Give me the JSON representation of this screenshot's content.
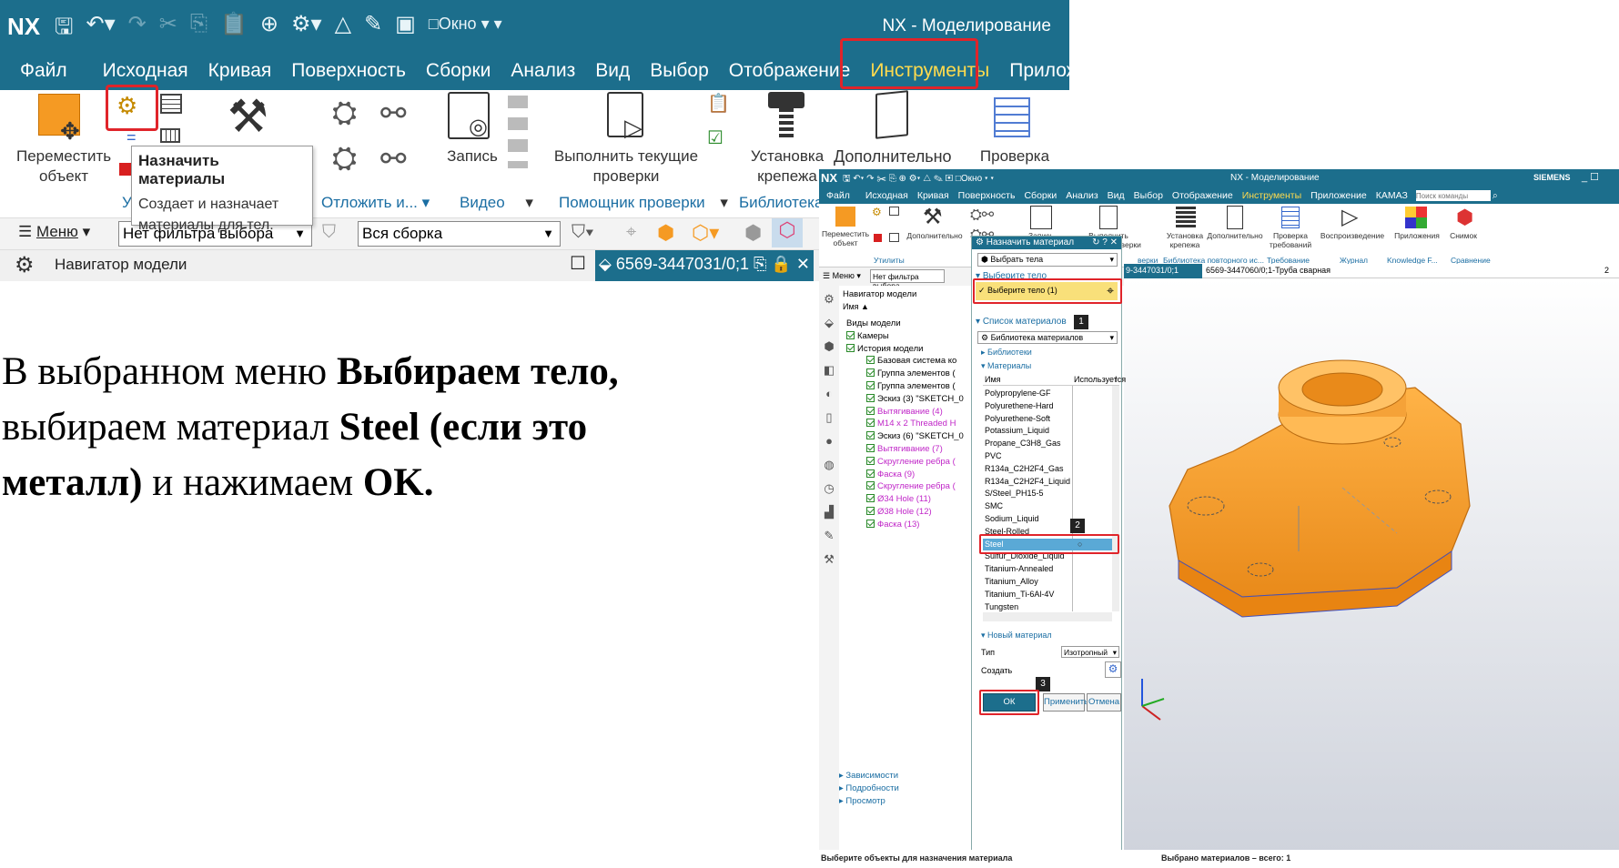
{
  "big": {
    "logo": "NX",
    "window_menu": "Окно",
    "window_title": "NX - Моделирование",
    "menu": [
      "Файл",
      "Исходная",
      "Кривая",
      "Поверхность",
      "Сборки",
      "Анализ",
      "Вид",
      "Выбор",
      "Отображение",
      "Инструменты",
      "Приложе"
    ],
    "active_menu": "Инструменты",
    "ribbon": {
      "move_object": "Переместить объект",
      "record": "Запись",
      "run_checks": "Выполнить текущие проверки",
      "fastener_install": "Установка крепежа",
      "additional": "Дополнительно",
      "check": "Проверка",
      "group_utilities": "У",
      "group_postpone": "Отложить и...",
      "group_video": "Видео",
      "group_check_assistant": "Помощник проверки",
      "group_library": "Библиотека"
    },
    "tooltip": {
      "title": "Назначить материалы",
      "description": "Создает и назначает материалы для тел."
    },
    "filter": {
      "menu": "Меню",
      "selection_filter": "Нет фильтра выбора",
      "scope": "Вся сборка"
    },
    "navigator": {
      "title": "Навигатор модели",
      "part_tab": "6569-3447031/0;1"
    }
  },
  "instructions": {
    "line1_normal": "В выбранном меню ",
    "line1_bold": "Выбираем тело,",
    "line2_normal": "выбираем материал ",
    "line2_bold": "Steel (если это",
    "line3_bold": "металл)",
    "line3_normal": " и нажимаем ",
    "line3_bold2": "OK."
  },
  "small": {
    "logo": "NX",
    "window_menu": "Окно",
    "window_title": "NX - Моделирование",
    "brand": "SIEMENS",
    "menu": [
      "Файл",
      "Исходная",
      "Кривая",
      "Поверхность",
      "Сборки",
      "Анализ",
      "Вид",
      "Выбор",
      "Отображение",
      "Инструменты",
      "Приложение",
      "КАМАЗ"
    ],
    "search_placeholder": "Поиск команды",
    "ribbon": {
      "move_object": "Переместить объект",
      "additional": "Дополнительно",
      "record": "Запись",
      "run_checks": "Выполнить текущие проверки",
      "fastener_install": "Установка крепежа",
      "additional2": "Дополнительно",
      "req_check": "Проверка требований",
      "playback": "Воспроизведение",
      "apps": "Приложения",
      "snapshot": "Снимок",
      "groups": [
        "Утилиты",
        "верки",
        "Библиотека повторного ис...",
        "Требование",
        "Журнал",
        "Knowledge F...",
        "Сравнение"
      ]
    },
    "filter": {
      "menu": "Меню",
      "selection_filter": "Нет фильтра выбора"
    },
    "navigator": {
      "title": "Навигатор модели",
      "column": "Имя",
      "rows": [
        {
          "label": "Виды модели",
          "pink": false
        },
        {
          "label": "Камеры",
          "pink": false
        },
        {
          "label": "История модели",
          "pink": false
        },
        {
          "label": "Базовая система ко",
          "pink": false
        },
        {
          "label": "Группа элементов (",
          "pink": false
        },
        {
          "label": "Группа элементов (",
          "pink": false
        },
        {
          "label": "Эскиз (3) \"SKETCH_0",
          "pink": false
        },
        {
          "label": "Вытягивание (4)",
          "pink": true
        },
        {
          "label": "M14 x 2 Threaded H",
          "pink": true
        },
        {
          "label": "Эскиз (6) \"SKETCH_0",
          "pink": false
        },
        {
          "label": "Вытягивание (7)",
          "pink": true
        },
        {
          "label": "Скругление ребра (",
          "pink": true
        },
        {
          "label": "Фаска (9)",
          "pink": true
        },
        {
          "label": "Скругление ребра (",
          "pink": true
        },
        {
          "label": "Ø34 Hole (11)",
          "pink": true
        },
        {
          "label": "Ø38 Hole (12)",
          "pink": true
        },
        {
          "label": "Фаска (13)",
          "pink": true
        }
      ],
      "footer": [
        "Зависимости",
        "Подробности",
        "Просмотр"
      ]
    },
    "dialog": {
      "title": "Назначить материал",
      "type_select": "Выбрать тела",
      "section_body": "Выберите тело",
      "select_body": "Выберите тело (1)",
      "section_materials": "Список материалов",
      "library_select": "Библиотека материалов",
      "libraries": "Библиотеки",
      "materials": "Материалы",
      "col_name": "Имя",
      "col_used": "Используется",
      "col_extra": "I",
      "material_list": [
        "Polypropylene-GF",
        "Polyurethene-Hard",
        "Polyurethene-Soft",
        "Potassium_Liquid",
        "Propane_C3H8_Gas",
        "PVC",
        "R134a_C2H2F4_Gas",
        "R134a_C2H2F4_Liquid",
        "S/Steel_PH15-5",
        "SMC",
        "Sodium_Liquid",
        "Steel-Rolled",
        "Steel",
        "Sulfur_Dioxide_Liquid",
        "Titanium-Annealed",
        "Titanium_Alloy",
        "Titanium_Ti-6Al-4V",
        "Tungsten"
      ],
      "selected_material": "Steel",
      "section_new": "Новый материал",
      "type_label": "Тип",
      "type_value": "Изотропный",
      "create_label": "Создать",
      "ok": "ОК",
      "apply": "Применить",
      "cancel": "Отмена",
      "badges": [
        "1",
        "2",
        "3"
      ]
    },
    "tabs": {
      "tab1": "9-3447031/0;1",
      "tab2": "6569-3447060/0;1-Труба сварная",
      "count": "2"
    },
    "status_left": "Выберите объекты для назначения материала",
    "status_right": "Выбрано материалов – всего: 1"
  },
  "colors": {
    "titlebar": "#1c6e8c",
    "accent_yellow": "#ffdb4d",
    "highlight_red": "#e0242a",
    "part_orange": "#f7a232",
    "selection_blue": "#5aa9d6"
  }
}
